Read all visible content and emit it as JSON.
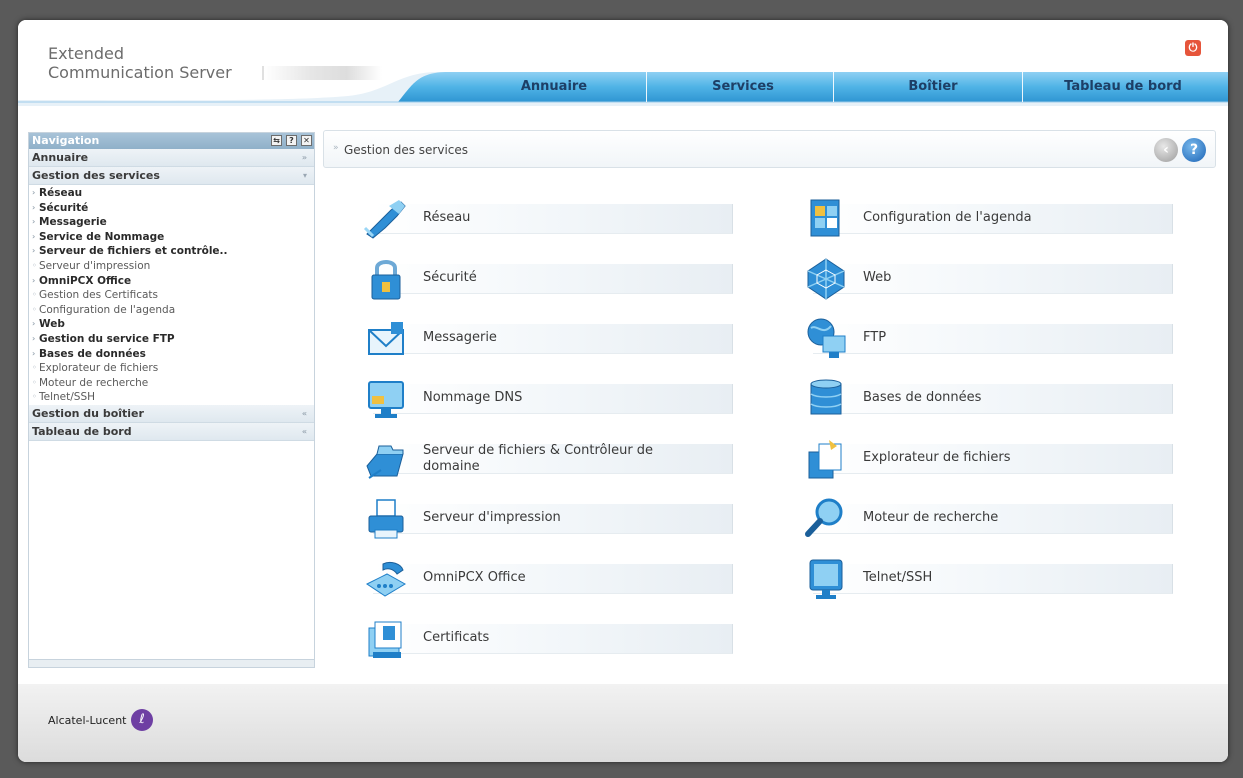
{
  "header": {
    "brand_line1": "Extended",
    "brand_line2": "Communication Server",
    "tabs": [
      {
        "label": "Annuaire"
      },
      {
        "label": "Services"
      },
      {
        "label": "Boîtier"
      },
      {
        "label": "Tableau de bord"
      }
    ],
    "power_icon": "power-icon"
  },
  "sidebar": {
    "title": "Navigation",
    "head_buttons": [
      "refresh-icon",
      "help-icon",
      "close-icon"
    ],
    "sections": [
      {
        "label": "Annuaire"
      },
      {
        "label": "Gestion des services"
      },
      {
        "label": "Gestion du boîtier"
      },
      {
        "label": "Tableau de bord"
      }
    ],
    "items": [
      {
        "label": "Réseau",
        "bold": true
      },
      {
        "label": "Sécurité",
        "bold": true
      },
      {
        "label": "Messagerie",
        "bold": true
      },
      {
        "label": "Service de Nommage",
        "bold": true
      },
      {
        "label": "Serveur de fichiers et contrôle..",
        "bold": true
      },
      {
        "label": "Serveur d'impression",
        "bold": false
      },
      {
        "label": "OmniPCX Office",
        "bold": true
      },
      {
        "label": "Gestion des Certificats",
        "bold": false
      },
      {
        "label": "Configuration de l'agenda",
        "bold": false
      },
      {
        "label": "Web",
        "bold": true
      },
      {
        "label": "Gestion du service FTP",
        "bold": true
      },
      {
        "label": "Bases de données",
        "bold": true
      },
      {
        "label": "Explorateur de fichiers",
        "bold": false
      },
      {
        "label": "Moteur de recherche",
        "bold": false
      },
      {
        "label": "Telnet/SSH",
        "bold": false
      }
    ]
  },
  "main": {
    "breadcrumb": "Gestion des services",
    "services_left": [
      {
        "label": "Réseau",
        "icon": "network-cable-icon"
      },
      {
        "label": "Sécurité",
        "icon": "padlock-icon"
      },
      {
        "label": "Messagerie",
        "icon": "mail-envelope-icon"
      },
      {
        "label": "Nommage DNS",
        "icon": "dns-monitor-icon"
      },
      {
        "label": "Serveur de fichiers & Contrôleur de domaine",
        "icon": "file-server-folder-icon"
      },
      {
        "label": "Serveur d'impression",
        "icon": "printer-icon"
      },
      {
        "label": "OmniPCX Office",
        "icon": "phone-icon"
      },
      {
        "label": "Certificats",
        "icon": "certificate-icon"
      }
    ],
    "services_right": [
      {
        "label": "Configuration de l'agenda",
        "icon": "calendar-icon"
      },
      {
        "label": "Web",
        "icon": "web-icon"
      },
      {
        "label": "FTP",
        "icon": "ftp-globe-icon"
      },
      {
        "label": "Bases de données",
        "icon": "database-icon"
      },
      {
        "label": "Explorateur de fichiers",
        "icon": "file-explorer-icon"
      },
      {
        "label": "Moteur de recherche",
        "icon": "search-magnifier-icon"
      },
      {
        "label": "Telnet/SSH",
        "icon": "terminal-monitor-icon"
      }
    ]
  },
  "footer": {
    "logo_text": "Alcatel-Lucent"
  },
  "colors": {
    "tab_blue": "#3aa3de",
    "accent_dark": "#1d3f66",
    "icon_blue": "#1f7fc8"
  }
}
